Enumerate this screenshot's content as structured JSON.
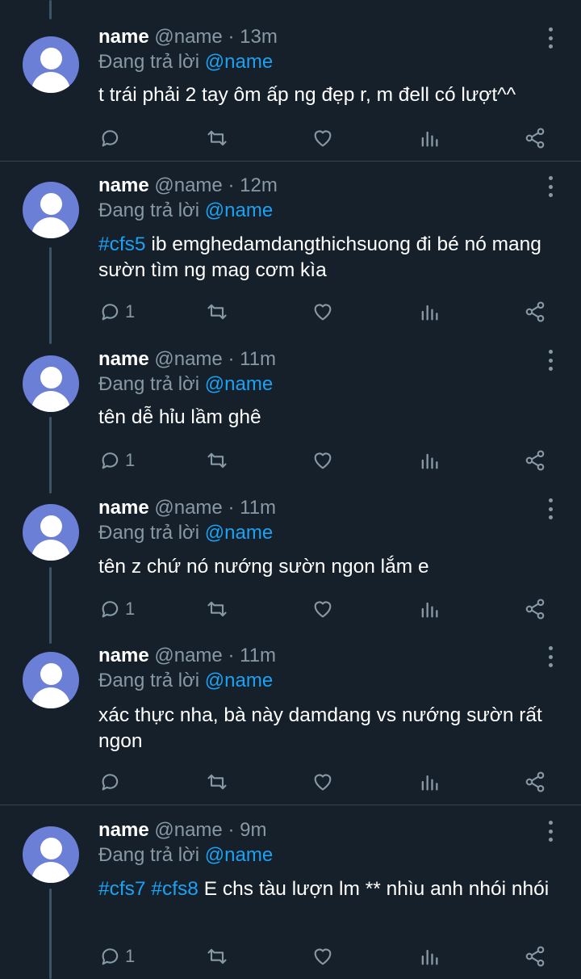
{
  "replies": [
    {
      "name": "name",
      "handle": "@name",
      "separator": "·",
      "time": "13m",
      "reply_prefix": "Đang trả lời",
      "reply_to": "@name",
      "hashtags": [],
      "text": "t trái phải 2 tay ôm ấp ng đẹp r, m đell có lượt^^",
      "reply_count": ""
    },
    {
      "name": "name",
      "handle": "@name",
      "separator": "·",
      "time": "12m",
      "reply_prefix": "Đang trả lời",
      "reply_to": "@name",
      "hashtags": [
        "#cfs5"
      ],
      "text": "ib emghedamdangthichsuong đi bé nó mang sườn tìm ng mag cơm kìa",
      "reply_count": "1"
    },
    {
      "name": "name",
      "handle": "@name",
      "separator": "·",
      "time": "11m",
      "reply_prefix": "Đang trả lời",
      "reply_to": "@name",
      "hashtags": [],
      "text": "tên dễ hỉu lầm ghê",
      "reply_count": "1"
    },
    {
      "name": "name",
      "handle": "@name",
      "separator": "·",
      "time": "11m",
      "reply_prefix": "Đang trả lời",
      "reply_to": "@name",
      "hashtags": [],
      "text": "tên z chứ nó nướng sườn ngon lắm e",
      "reply_count": "1"
    },
    {
      "name": "name",
      "handle": "@name",
      "separator": "·",
      "time": "11m",
      "reply_prefix": "Đang trả lời",
      "reply_to": "@name",
      "hashtags": [],
      "text": "xác thực nha, bà này damdang vs nướng sườn rất ngon",
      "reply_count": ""
    },
    {
      "name": "name",
      "handle": "@name",
      "separator": "·",
      "time": "9m",
      "reply_prefix": "Đang trả lời",
      "reply_to": "@name",
      "hashtags": [
        "#cfs7",
        "#cfs8"
      ],
      "text": "E chs tàu lượn lm ** nhìu anh nhói nhói",
      "reply_count": "1"
    }
  ],
  "icons": {
    "reply": "reply-icon",
    "retweet": "retweet-icon",
    "like": "heart-icon",
    "analytics": "analytics-icon",
    "share": "share-icon",
    "more": "more-vertical-icon"
  },
  "colors": {
    "background": "#15202b",
    "text": "#ffffff",
    "secondary": "#8899a6",
    "accent": "#1da1f2",
    "divider": "#38444d",
    "avatar": "#6b7fd7"
  }
}
